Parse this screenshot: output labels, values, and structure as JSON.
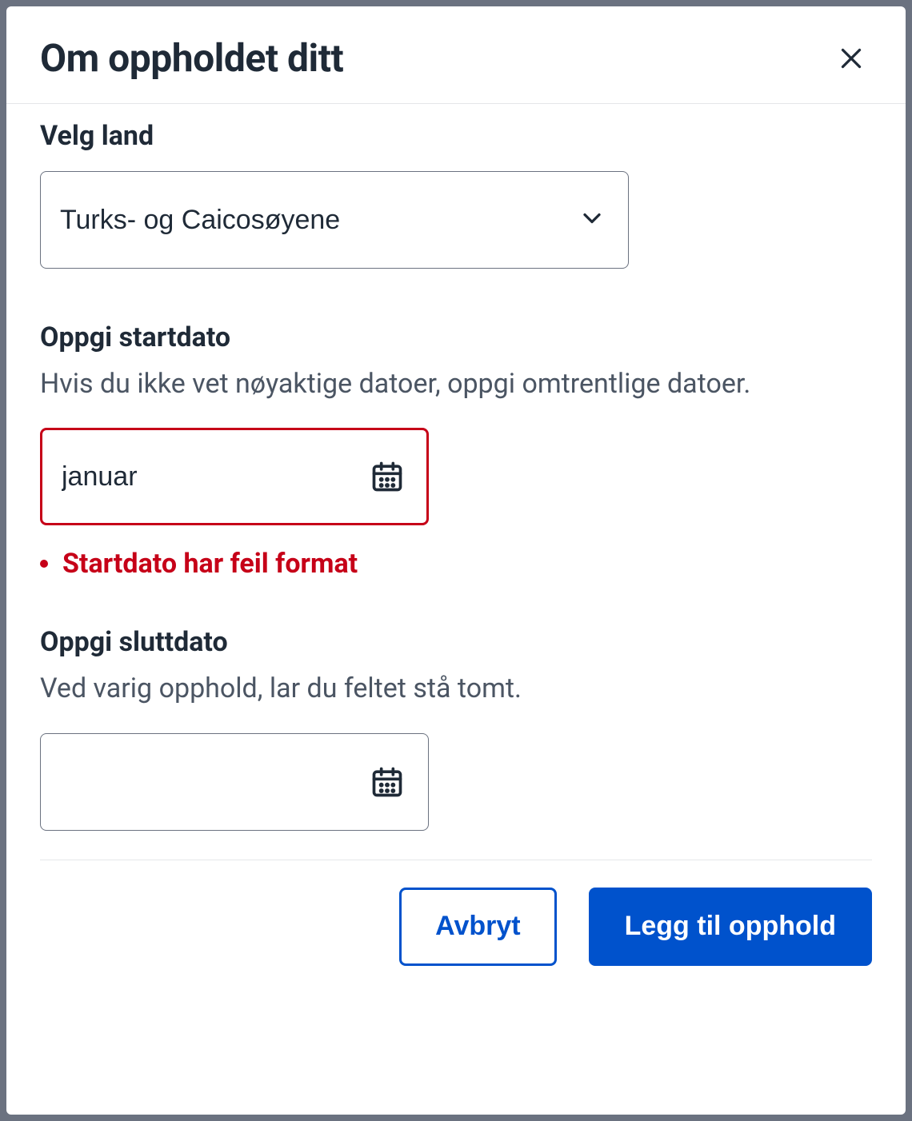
{
  "dialog": {
    "title": "Om oppholdet ditt"
  },
  "country": {
    "label": "Velg land",
    "selected": "Turks- og Caicosøyene"
  },
  "start_date": {
    "label": "Oppgi startdato",
    "help": "Hvis du ikke vet nøyaktige datoer, oppgi omtrentlige datoer.",
    "value": "januar",
    "error": "Startdato har feil format"
  },
  "end_date": {
    "label": "Oppgi sluttdato",
    "help": "Ved varig opphold, lar du feltet stå tomt.",
    "value": ""
  },
  "footer": {
    "cancel": "Avbryt",
    "submit": "Legg til opphold"
  },
  "colors": {
    "error": "#c60018",
    "primary": "#0052cc"
  }
}
